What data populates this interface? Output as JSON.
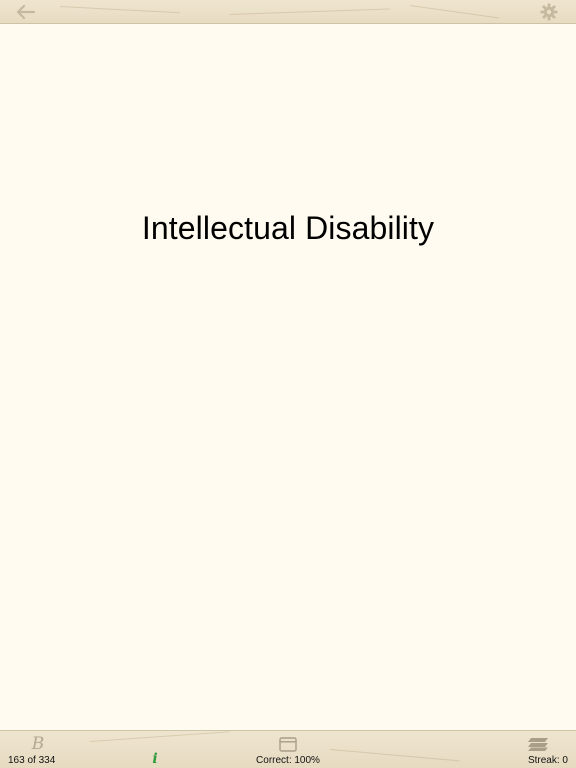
{
  "toolbar": {
    "back_icon": "back-arrow-icon",
    "settings_icon": "gear-icon"
  },
  "card": {
    "title": "Intellectual Disability"
  },
  "footer": {
    "bookmark_glyph": "B",
    "info_glyph": "i",
    "counter": "163 of 334",
    "correct": "Correct: 100%",
    "streak": "Streak: 0",
    "card_icon": "card-view-icon",
    "deck_icon": "deck-stack-icon"
  },
  "colors": {
    "background": "#fffbf1",
    "bar": "#ebe0c8",
    "icon_muted": "#b3a891",
    "info_green": "#2e9a3b",
    "text": "#000000"
  }
}
